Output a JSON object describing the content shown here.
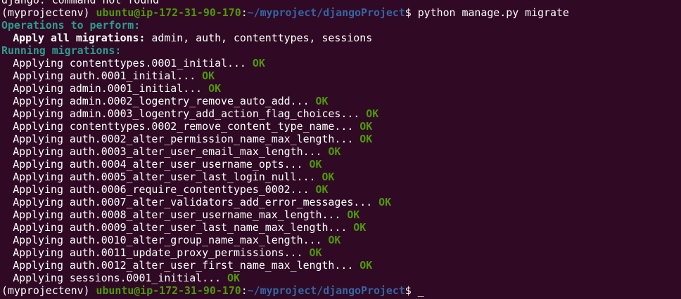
{
  "clipped_line": "django: command not found",
  "prompt": {
    "env": "(myprojectenv) ",
    "user_host": "ubuntu@ip-172-31-90-170",
    "colon": ":",
    "path": "~/myproject/djangoProject",
    "symbol": "$ "
  },
  "command": "python manage.py migrate",
  "operations_header": "Operations to perform:",
  "apply_all_label": "Apply all migrations:",
  "apply_all_apps": " admin, auth, contenttypes, sessions",
  "running_header": "Running migrations:",
  "ok_label": "OK",
  "migrations": [
    "Applying contenttypes.0001_initial... ",
    "Applying auth.0001_initial... ",
    "Applying admin.0001_initial... ",
    "Applying admin.0002_logentry_remove_auto_add... ",
    "Applying admin.0003_logentry_add_action_flag_choices... ",
    "Applying contenttypes.0002_remove_content_type_name... ",
    "Applying auth.0002_alter_permission_name_max_length... ",
    "Applying auth.0003_alter_user_email_max_length... ",
    "Applying auth.0004_alter_user_username_opts... ",
    "Applying auth.0005_alter_user_last_login_null... ",
    "Applying auth.0006_require_contenttypes_0002... ",
    "Applying auth.0007_alter_validators_add_error_messages... ",
    "Applying auth.0008_alter_user_username_max_length... ",
    "Applying auth.0009_alter_user_last_name_max_length... ",
    "Applying auth.0010_alter_group_name_max_length... ",
    "Applying auth.0011_update_proxy_permissions... ",
    "Applying auth.0012_alter_user_first_name_max_length... ",
    "Applying sessions.0001_initial... "
  ],
  "cursor": "_"
}
